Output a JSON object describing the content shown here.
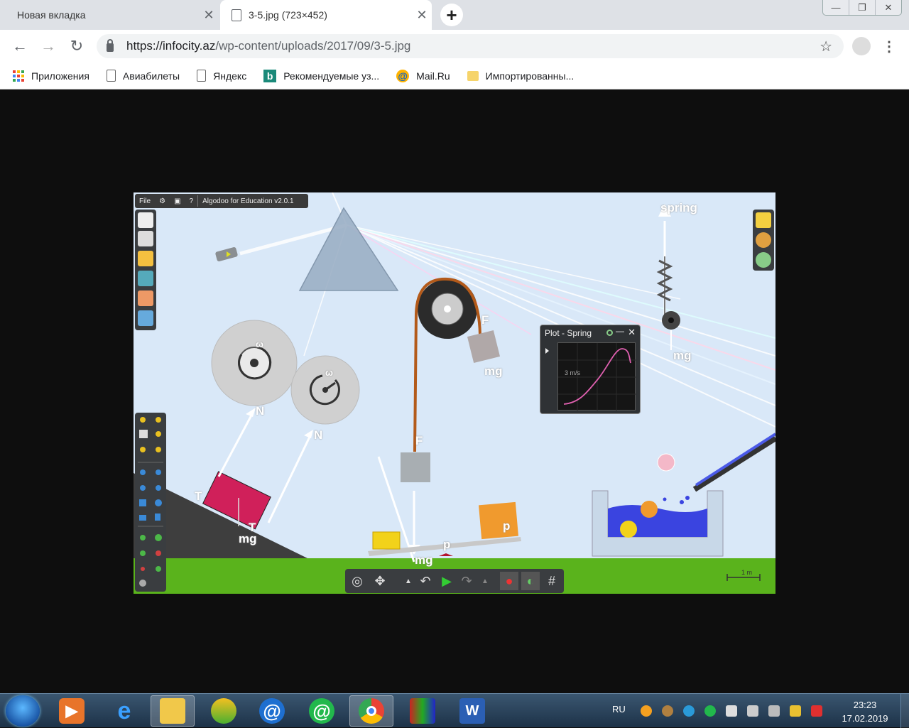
{
  "browser": {
    "tabs": [
      {
        "title": "Новая вкладка",
        "active": false
      },
      {
        "title": "3-5.jpg (723×452)",
        "active": true
      }
    ],
    "new_tab_symbol": "+",
    "close_symbol": "✕",
    "window_controls": {
      "minimize": "—",
      "restore": "❐",
      "close": "✕"
    },
    "url_host": "https://infocity.az",
    "url_path": "/wp-content/uploads/2017/09/3-5.jpg",
    "nav": {
      "back": "←",
      "forward": "→",
      "reload": "↻",
      "star": "☆",
      "menu": "⋮"
    },
    "bookmarks": [
      {
        "label": "Приложения",
        "icon": "apps-icon"
      },
      {
        "label": "Авиабилеты",
        "icon": "page-icon"
      },
      {
        "label": "Яндекс",
        "icon": "page-icon"
      },
      {
        "label": "Рекомендуемые уз...",
        "icon": "bing-icon"
      },
      {
        "label": "Mail.Ru",
        "icon": "mailru-icon"
      },
      {
        "label": "Импортированны...",
        "icon": "folder-icon"
      }
    ]
  },
  "image": {
    "menubar": {
      "file": "File",
      "help": "?",
      "app_title": "Algodoo for Education v2.0.1"
    },
    "labels": {
      "spring": "spring",
      "mg": "mg",
      "F": "F",
      "N": "N",
      "T": "T",
      "p": "p",
      "omega": "ω"
    },
    "plot": {
      "title": "Plot - Spring",
      "y_label": "3 m/s",
      "close": "✕",
      "minimize": "—"
    },
    "scale": "1 m",
    "colors": {
      "sky": "#d9e8f8",
      "ground": "#5ab31c",
      "crate": "#d0205a",
      "water": "#3a44e0",
      "box_orange": "#f09a2e",
      "box_yellow": "#f2d21a",
      "rope": "#b35a1a"
    }
  },
  "taskbar": {
    "apps": [
      {
        "name": "media-player-icon"
      },
      {
        "name": "internet-explorer-icon"
      },
      {
        "name": "file-explorer-icon"
      },
      {
        "name": "algodoo-icon"
      },
      {
        "name": "mail-agent-icon"
      },
      {
        "name": "icq-icon"
      },
      {
        "name": "chrome-icon",
        "active": true
      },
      {
        "name": "winrar-icon"
      },
      {
        "name": "word-icon"
      }
    ],
    "lang": "RU",
    "time": "23:23",
    "date": "17.02.2019"
  }
}
